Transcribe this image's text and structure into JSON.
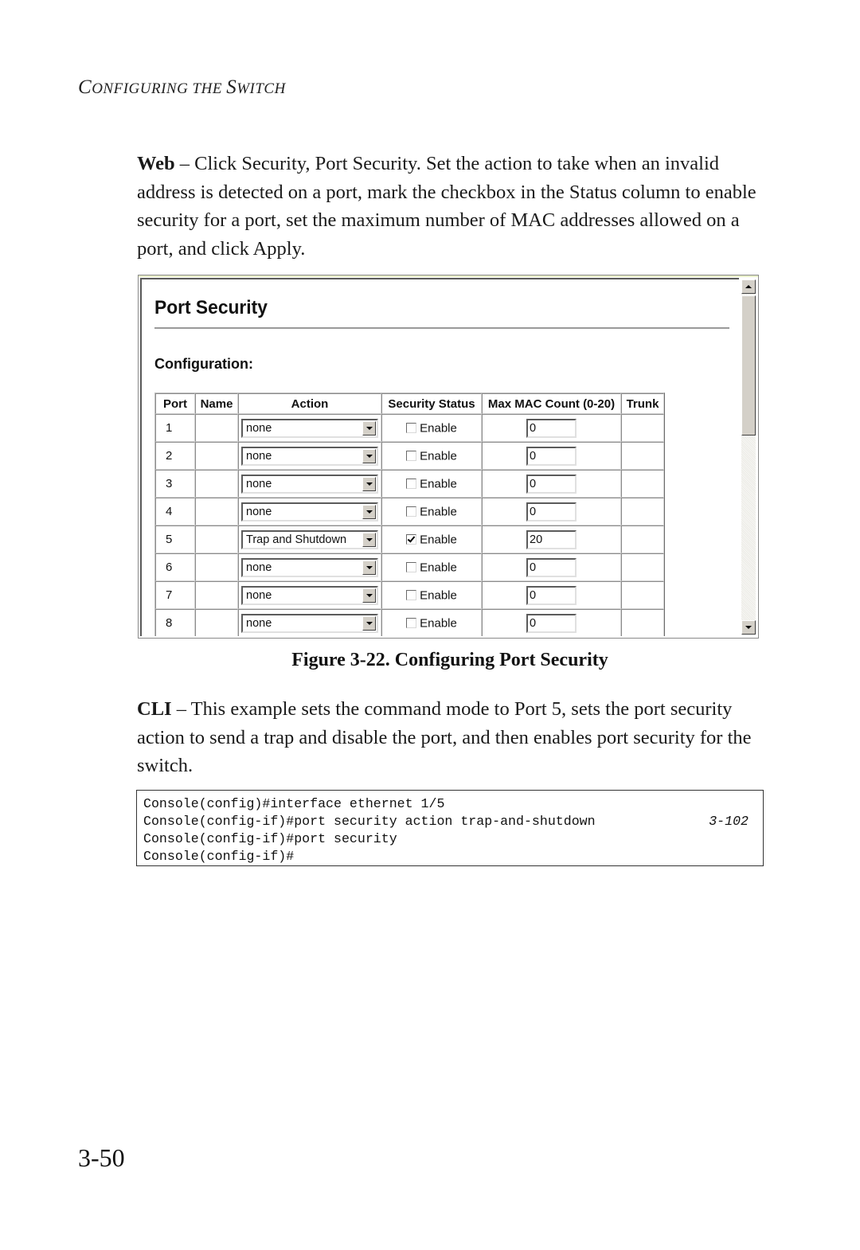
{
  "running_head": {
    "first": "C",
    "rest1": "ONFIGURING THE ",
    "second": "S",
    "rest2": "WITCH"
  },
  "intro": {
    "lead": "Web",
    "text": " – Click Security, Port Security. Set the action to take when an invalid address is detected on a port, mark the checkbox in the Status column to enable security for a port, set the maximum number of MAC addresses allowed on a port, and click Apply."
  },
  "figure": {
    "title": "Port Security",
    "subtitle": "Configuration:",
    "columns": [
      "Port",
      "Name",
      "Action",
      "Security Status",
      "Max MAC Count (0-20)",
      "Trunk"
    ],
    "rows": [
      {
        "port": "1",
        "name": "",
        "action": "none",
        "status_label": "Enable",
        "enabled": false,
        "max_mac": "0",
        "trunk": ""
      },
      {
        "port": "2",
        "name": "",
        "action": "none",
        "status_label": "Enable",
        "enabled": false,
        "max_mac": "0",
        "trunk": ""
      },
      {
        "port": "3",
        "name": "",
        "action": "none",
        "status_label": "Enable",
        "enabled": false,
        "max_mac": "0",
        "trunk": ""
      },
      {
        "port": "4",
        "name": "",
        "action": "none",
        "status_label": "Enable",
        "enabled": false,
        "max_mac": "0",
        "trunk": ""
      },
      {
        "port": "5",
        "name": "",
        "action": "Trap and Shutdown",
        "status_label": "Enable",
        "enabled": true,
        "max_mac": "20",
        "trunk": ""
      },
      {
        "port": "6",
        "name": "",
        "action": "none",
        "status_label": "Enable",
        "enabled": false,
        "max_mac": "0",
        "trunk": ""
      },
      {
        "port": "7",
        "name": "",
        "action": "none",
        "status_label": "Enable",
        "enabled": false,
        "max_mac": "0",
        "trunk": ""
      },
      {
        "port": "8",
        "name": "",
        "action": "none",
        "status_label": "Enable",
        "enabled": false,
        "max_mac": "0",
        "trunk": ""
      }
    ],
    "caption": "Figure 3-22.  Configuring Port Security"
  },
  "cli": {
    "lead": "CLI",
    "text": " – This example sets the command mode to Port 5, sets the port security action to send a trap and disable the port, and then enables port security for the switch.",
    "lines": [
      {
        "cmd": "Console(config)#interface ethernet 1/5",
        "ref": ""
      },
      {
        "cmd": "Console(config-if)#port security action trap-and-shutdown",
        "ref": "3-102"
      },
      {
        "cmd": "Console(config-if)#port security",
        "ref": ""
      },
      {
        "cmd": "Console(config-if)#",
        "ref": ""
      }
    ]
  },
  "page_number": "3-50"
}
